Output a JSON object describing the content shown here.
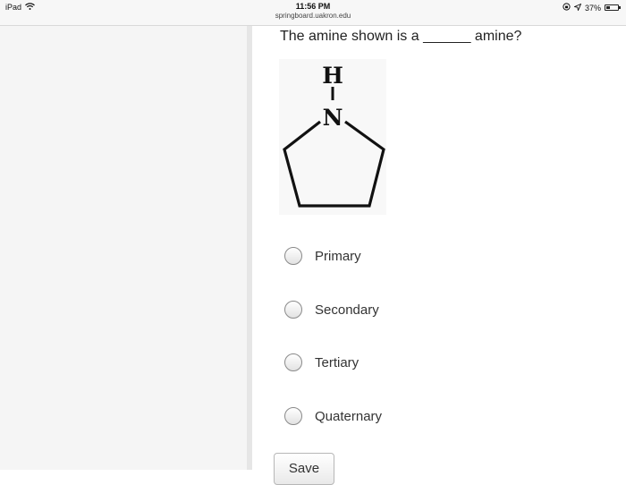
{
  "status_bar": {
    "device": "iPad",
    "time": "11:56 PM",
    "url": "springboard.uakron.edu",
    "battery": "37%",
    "battery_level": 0.37
  },
  "question": {
    "text": "The amine shown is a ______ amine?",
    "molecule_atoms": {
      "hydrogen": "H",
      "nitrogen": "N"
    },
    "options": [
      {
        "label": "Primary",
        "selected": false
      },
      {
        "label": "Secondary",
        "selected": false
      },
      {
        "label": "Tertiary",
        "selected": false
      },
      {
        "label": "Quaternary",
        "selected": false
      }
    ]
  },
  "save_label": "Save",
  "icons": [
    "wifi-icon",
    "location-icon",
    "battery-icon",
    "orientation-lock-icon",
    "radio-icon"
  ]
}
